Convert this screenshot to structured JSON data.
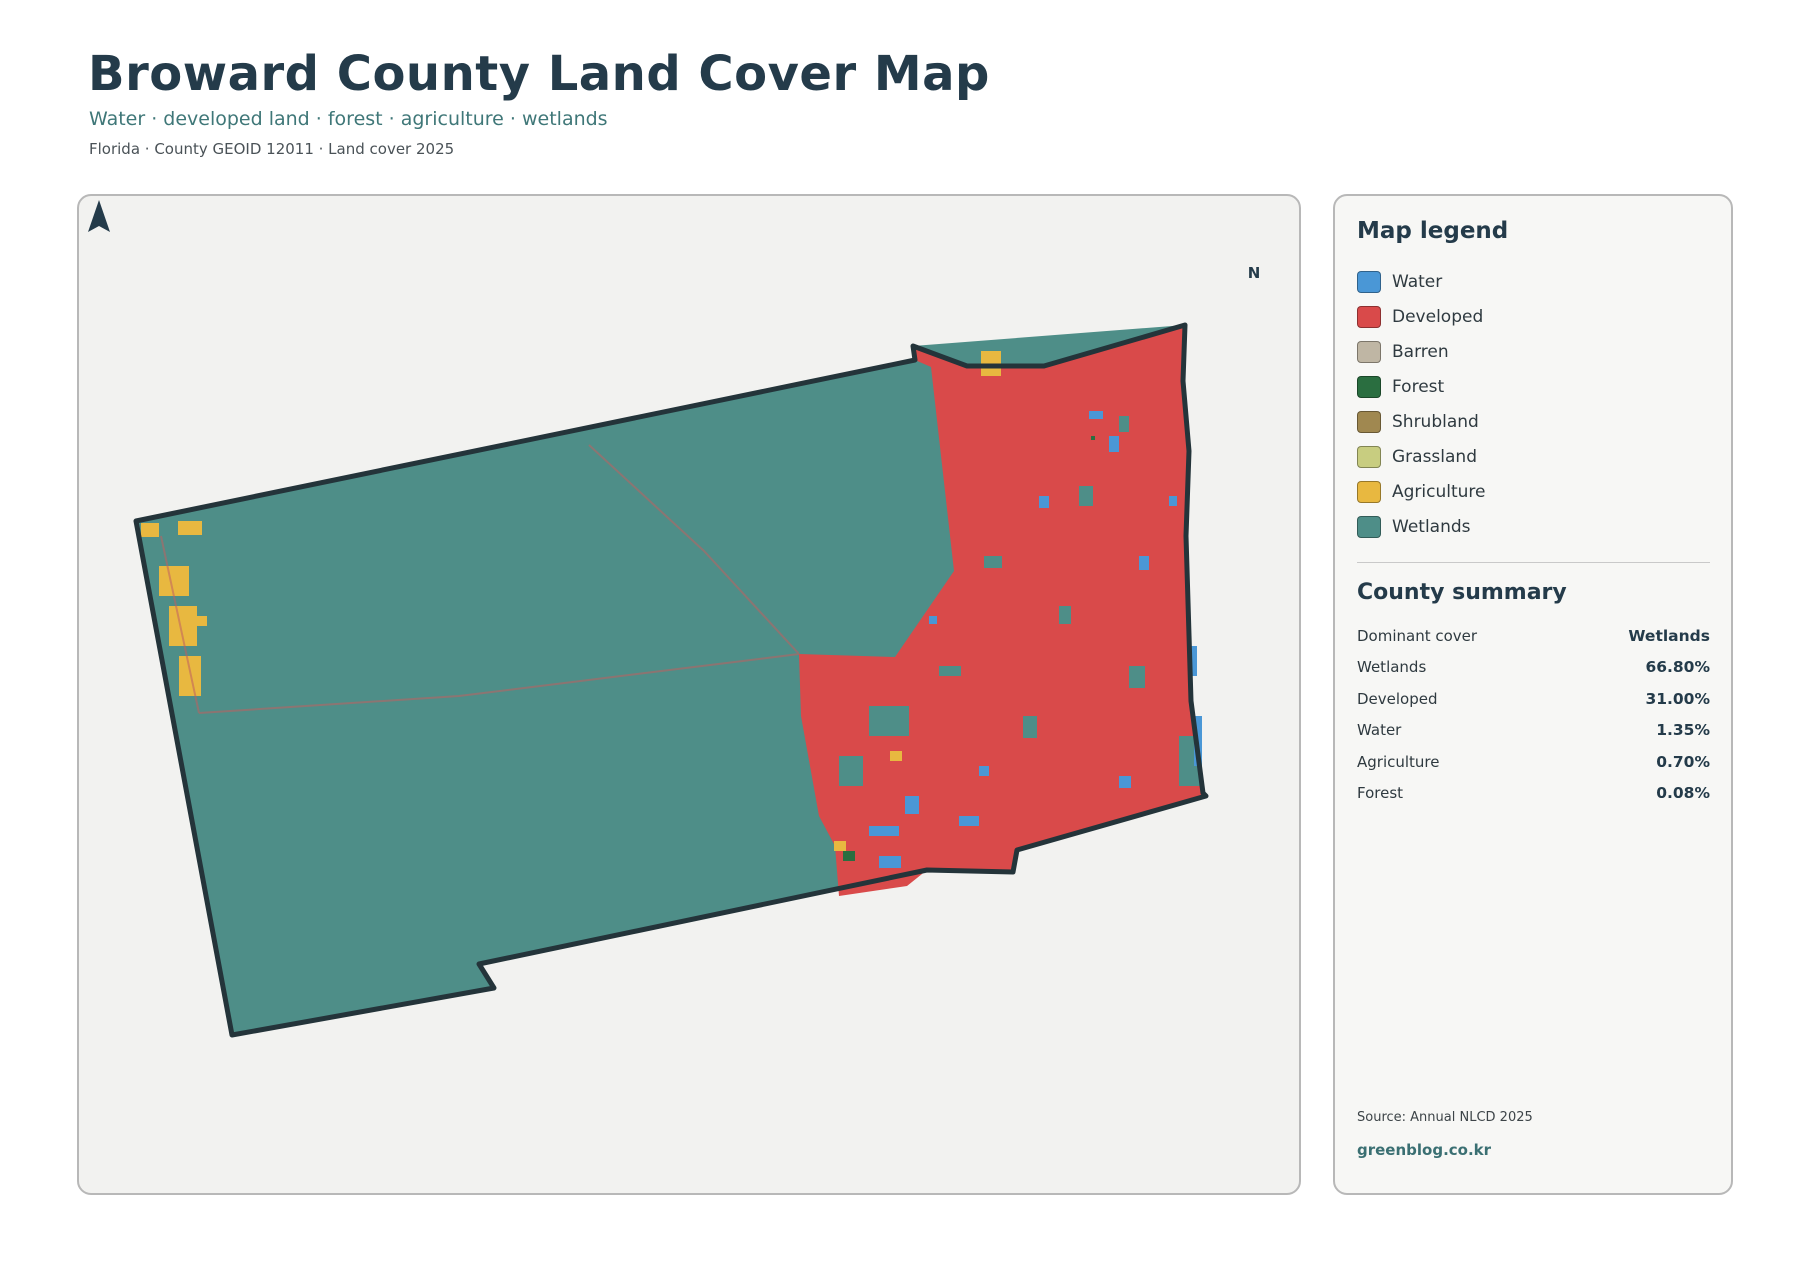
{
  "header": {
    "title": "Broward County Land Cover Map",
    "subtitle": "Water · developed land · forest · agriculture · wetlands",
    "meta": "Florida · County GEOID 12011 · Land cover 2025"
  },
  "map": {
    "north_label": "N",
    "colors": {
      "water": "#4a97d6",
      "developed": "#d94a4a",
      "barren": "#bfb6a4",
      "forest": "#2a6e40",
      "shrubland": "#a08850",
      "grassland": "#c8cd80",
      "agriculture": "#e8b840",
      "wetlands": "#4e8e88",
      "boundary": "#24343a"
    }
  },
  "legend": {
    "title": "Map legend",
    "items": [
      {
        "label": "Water",
        "color": "#4a97d6"
      },
      {
        "label": "Developed",
        "color": "#d94a4a"
      },
      {
        "label": "Barren",
        "color": "#bfb6a4"
      },
      {
        "label": "Forest",
        "color": "#2a6e40"
      },
      {
        "label": "Shrubland",
        "color": "#a08850"
      },
      {
        "label": "Grassland",
        "color": "#c8cd80"
      },
      {
        "label": "Agriculture",
        "color": "#e8b840"
      },
      {
        "label": "Wetlands",
        "color": "#4e8e88"
      }
    ]
  },
  "summary": {
    "title": "County summary",
    "rows": [
      {
        "key": "Dominant cover",
        "value": "Wetlands"
      },
      {
        "key": "Wetlands",
        "value": "66.80%"
      },
      {
        "key": "Developed",
        "value": "31.00%"
      },
      {
        "key": "Water",
        "value": "1.35%"
      },
      {
        "key": "Agriculture",
        "value": "0.70%"
      },
      {
        "key": "Forest",
        "value": "0.08%"
      }
    ]
  },
  "footer": {
    "source": "Source: Annual NLCD 2025",
    "brand": "greenblog.co.kr"
  }
}
